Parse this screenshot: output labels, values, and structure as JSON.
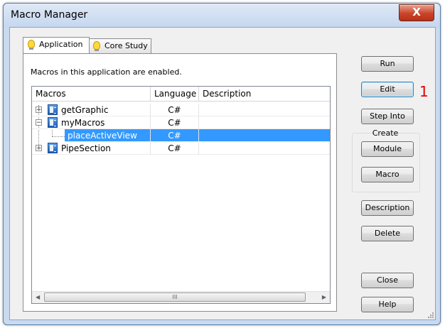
{
  "window": {
    "title": "Macro Manager",
    "close_glyph": "X"
  },
  "tabs": [
    {
      "label": "Application",
      "icon": "lightbulb-icon"
    },
    {
      "label": "Core Study",
      "icon": "lightbulb-icon"
    }
  ],
  "info_text": "Macros in this application are enabled.",
  "grid": {
    "columns": [
      "Macros",
      "Language",
      "Description"
    ],
    "rows": [
      {
        "name": "getGraphic",
        "language": "C#",
        "description": "",
        "expander": "+"
      },
      {
        "name": "myMacros",
        "language": "C#",
        "description": "",
        "expander": "−"
      },
      {
        "name": "placeActiveView",
        "language": "C#",
        "description": "",
        "selected": true
      },
      {
        "name": "PipeSection",
        "language": "C#",
        "description": "",
        "expander": "+"
      }
    ],
    "scroll_thumb": "III"
  },
  "buttons": {
    "run": "Run",
    "edit": "Edit",
    "step_into": "Step Into",
    "create_label": "Create",
    "module": "Module",
    "macro": "Macro",
    "description": "Description",
    "delete": "Delete",
    "close": "Close",
    "help": "Help"
  },
  "annotation": "1",
  "colors": {
    "selection": "#3399ff",
    "annotation": "#e00000",
    "close_button": "#c8442a"
  }
}
